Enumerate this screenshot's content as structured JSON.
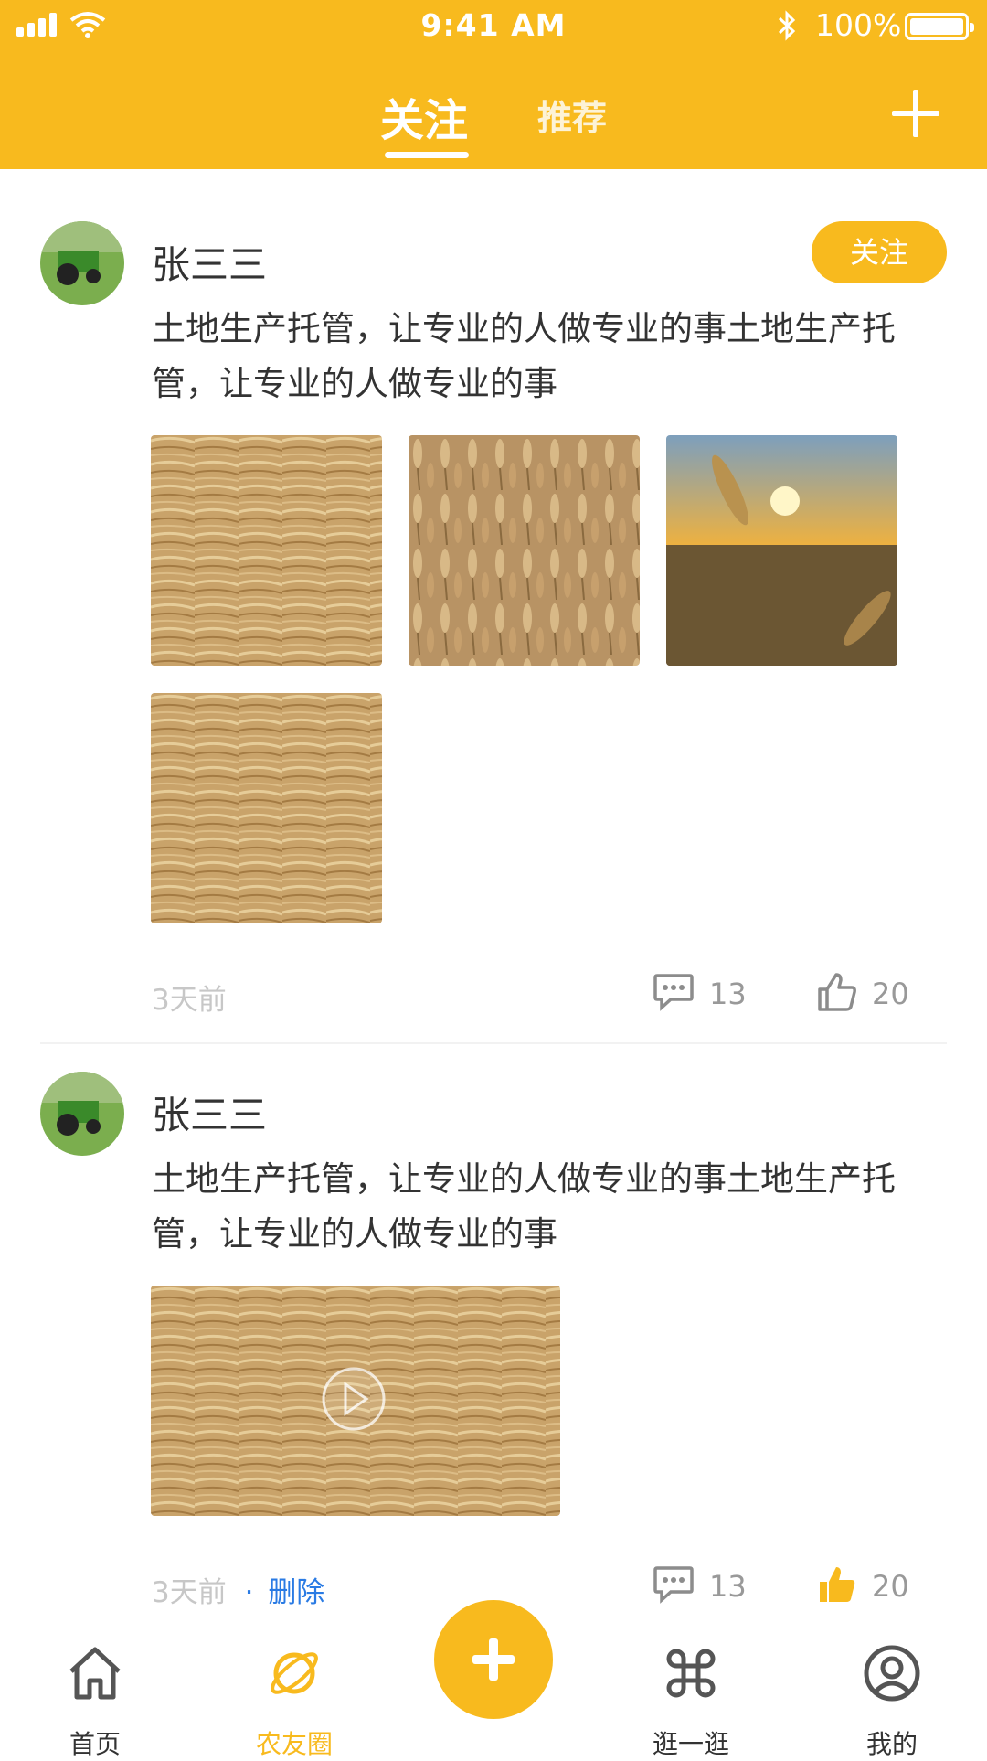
{
  "status_bar": {
    "time": "9:41 AM",
    "battery": "100%"
  },
  "header": {
    "tabs": [
      {
        "label": "关注",
        "active": true
      },
      {
        "label": "推荐",
        "active": false
      }
    ]
  },
  "posts": [
    {
      "username": "张三三",
      "follow_label": "关注",
      "text": "土地生产托管，让专业的人做专业的事土地生产托管，让专业的人做专业的事",
      "time": "3天前",
      "comments": "13",
      "likes": "20",
      "liked": false
    },
    {
      "username": "张三三",
      "text": "土地生产托管，让专业的人做专业的事土地生产托管，让专业的人做专业的事",
      "time": "3天前",
      "separator": "·",
      "delete_label": "删除",
      "comments": "13",
      "likes": "20",
      "liked": true
    }
  ],
  "tabbar": {
    "items": [
      {
        "label": "首页",
        "icon": "home-icon",
        "active": false
      },
      {
        "label": "农友圈",
        "icon": "planet-icon",
        "active": true
      },
      {
        "label": "",
        "icon": "plus-icon",
        "active": false
      },
      {
        "label": "逛一逛",
        "icon": "command-icon",
        "active": false
      },
      {
        "label": "我的",
        "icon": "user-icon",
        "active": false
      }
    ]
  },
  "colors": {
    "brand": "#F8BA1E",
    "link": "#2a7be4",
    "muted": "#c7c7c7"
  }
}
